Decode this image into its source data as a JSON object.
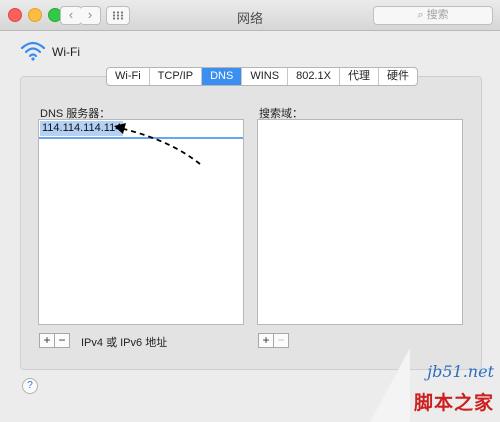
{
  "window": {
    "title": "网络"
  },
  "toolbar": {
    "back_glyph": "‹",
    "forward_glyph": "›",
    "search_placeholder": "搜索",
    "search_icon": "search-icon"
  },
  "header": {
    "title": "Wi-Fi",
    "icon": "wifi-icon"
  },
  "tabs": [
    {
      "label": "Wi-Fi"
    },
    {
      "label": "TCP/IP"
    },
    {
      "label": "DNS",
      "active": true
    },
    {
      "label": "WINS"
    },
    {
      "label": "802.1X"
    },
    {
      "label": "代理"
    },
    {
      "label": "硬件"
    }
  ],
  "dns": {
    "label": "DNS 服务器：",
    "servers": [
      "114.114.114.114"
    ],
    "add": "+",
    "remove": "−",
    "hint": "IPv4 或 IPv6 地址"
  },
  "search_domains": {
    "label": "搜索域：",
    "add": "+",
    "remove": "−"
  },
  "help": "?",
  "watermark": {
    "site": "jb51.net",
    "name": "脚本之家"
  },
  "colors": {
    "accent": "#3a8ff0",
    "selection": "#b4d1f5"
  }
}
